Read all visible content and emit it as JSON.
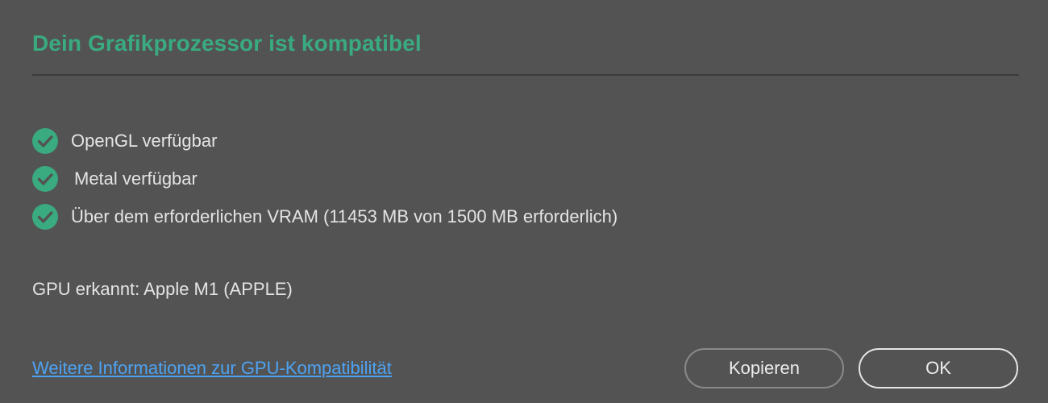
{
  "dialog": {
    "title": "Dein Grafikprozessor ist kompatibel",
    "accent_color": "#3aaa80",
    "checks": [
      {
        "icon": "check-circle-icon",
        "label": "OpenGL verfügbar"
      },
      {
        "icon": "check-circle-icon",
        "label": "Metal verfügbar"
      },
      {
        "icon": "check-circle-icon",
        "label": "Über dem erforderlichen VRAM (11453 MB von 1500 MB erforderlich)"
      }
    ],
    "gpu_detected": "GPU erkannt: Apple M1 (APPLE)",
    "info_link": "Weitere Informationen zur GPU-Kompatibilität",
    "buttons": {
      "copy_label": "Kopieren",
      "ok_label": "OK"
    }
  }
}
